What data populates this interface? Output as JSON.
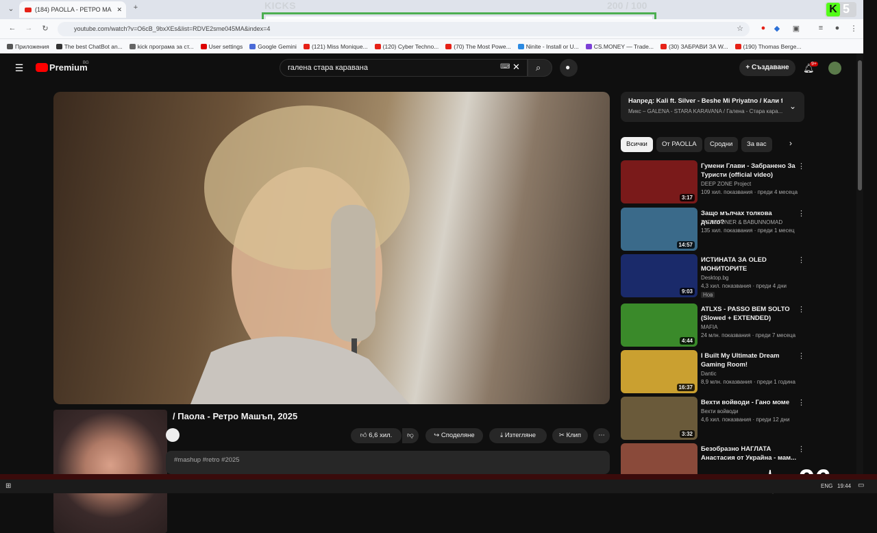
{
  "browser": {
    "tab_title": "(184) PAOLLA - РЕТРО МА",
    "url": "youtube.com/watch?v=O6cB_9bxXEs&list=RDVE2sme045MA&index=4",
    "bookmarks": [
      "Приложения",
      "The best ChatBot an...",
      "kick програма за ст...",
      "User settings",
      "Google Gemini",
      "(121) Miss Monique...",
      "(120) Cyber Techno...",
      "(70) The Most Powe...",
      "Ninite - Install or U...",
      "CS.MONEY — Trade...",
      "(30) ЗАБРАВИ ЗА W...",
      "(190) Thomas Berge..."
    ],
    "bookmark_colors": [
      "#555",
      "#333",
      "#666",
      "#d00",
      "#4b6bd8",
      "#e62117",
      "#e62117",
      "#e62117",
      "#2b8ae2",
      "#7b3fd6",
      "#e62117",
      "#e62117"
    ]
  },
  "overlay": {
    "kicks_label": "KICKS",
    "kicks_count": "200 / 100",
    "kick_badge": "K",
    "kick_number": "5",
    "heart_rate": "96"
  },
  "youtube": {
    "logo_text": "Premium",
    "region": "BG",
    "search_value": "галена стара каравана",
    "create_label": "Създаване",
    "notifications": "9+",
    "video_title": "/ Паола - Ретро Машъп, 2025",
    "likes": "6,6 хил.",
    "share_label": "Споделяне",
    "download_label": "Изтегляне",
    "clip_label": "Клип",
    "description": "#mashup #retro #2025",
    "next_title": "Напред: Kali ft. Silver - Beshe Mi Priyatno / Кали ft....",
    "next_subtitle": "Микс – GALENA - STARA KARAVANA / Галена - Стара кара...",
    "chips": [
      "Всички",
      "От PAOLLA",
      "Сродни",
      "За вас"
    ],
    "items": [
      {
        "title": "Гумени Глави - Забранено За Туристи (official video)",
        "channel": "DEEP ZONE Project",
        "stats": "109 хил. показвания · преди 4 месеца",
        "duration": "3:17",
        "badge": ""
      },
      {
        "title": "Защо мълчах толкова дълго?",
        "channel": "TATTSTONER & BABUNNOMAD",
        "stats": "135 хил. показвания · преди 1 месец",
        "duration": "14:57",
        "badge": ""
      },
      {
        "title": "ИСТИНАТА ЗА OLED МОНИТОРИТЕ",
        "channel": "Desktop.bg",
        "stats": "4,3 хил. показвания · преди 4 дни",
        "duration": "9:03",
        "badge": "Нов"
      },
      {
        "title": "ATLXS - PASSO BEM SOLTO (Slowed + EXTENDED)",
        "channel": "MAFIA",
        "stats": "24 млн. показвания · преди 7 месеца",
        "duration": "4:44",
        "badge": ""
      },
      {
        "title": "I Built My Ultimate Dream Gaming Room!",
        "channel": "Dantic",
        "stats": "8,9 млн. показвания · преди 1 година",
        "duration": "16:37",
        "badge": ""
      },
      {
        "title": "Вехти войводи - Гано моме",
        "channel": "Вехти войводи",
        "stats": "4,6 хил. показвания · преди 12 дни",
        "duration": "3:32",
        "badge": ""
      },
      {
        "title": "Безобразно НАГЛАТА Анастасия от Украйна - мам...",
        "channel": "",
        "stats": "",
        "duration": "",
        "badge": ""
      }
    ],
    "thumb_colors": [
      "#7a1a1a",
      "#3a6a8a",
      "#1a2a6a",
      "#3a8a2a",
      "#caa030",
      "#6a5a3a",
      "#8a4a3a"
    ]
  },
  "taskbar": {
    "lang": "ENG",
    "time": "19:44"
  }
}
